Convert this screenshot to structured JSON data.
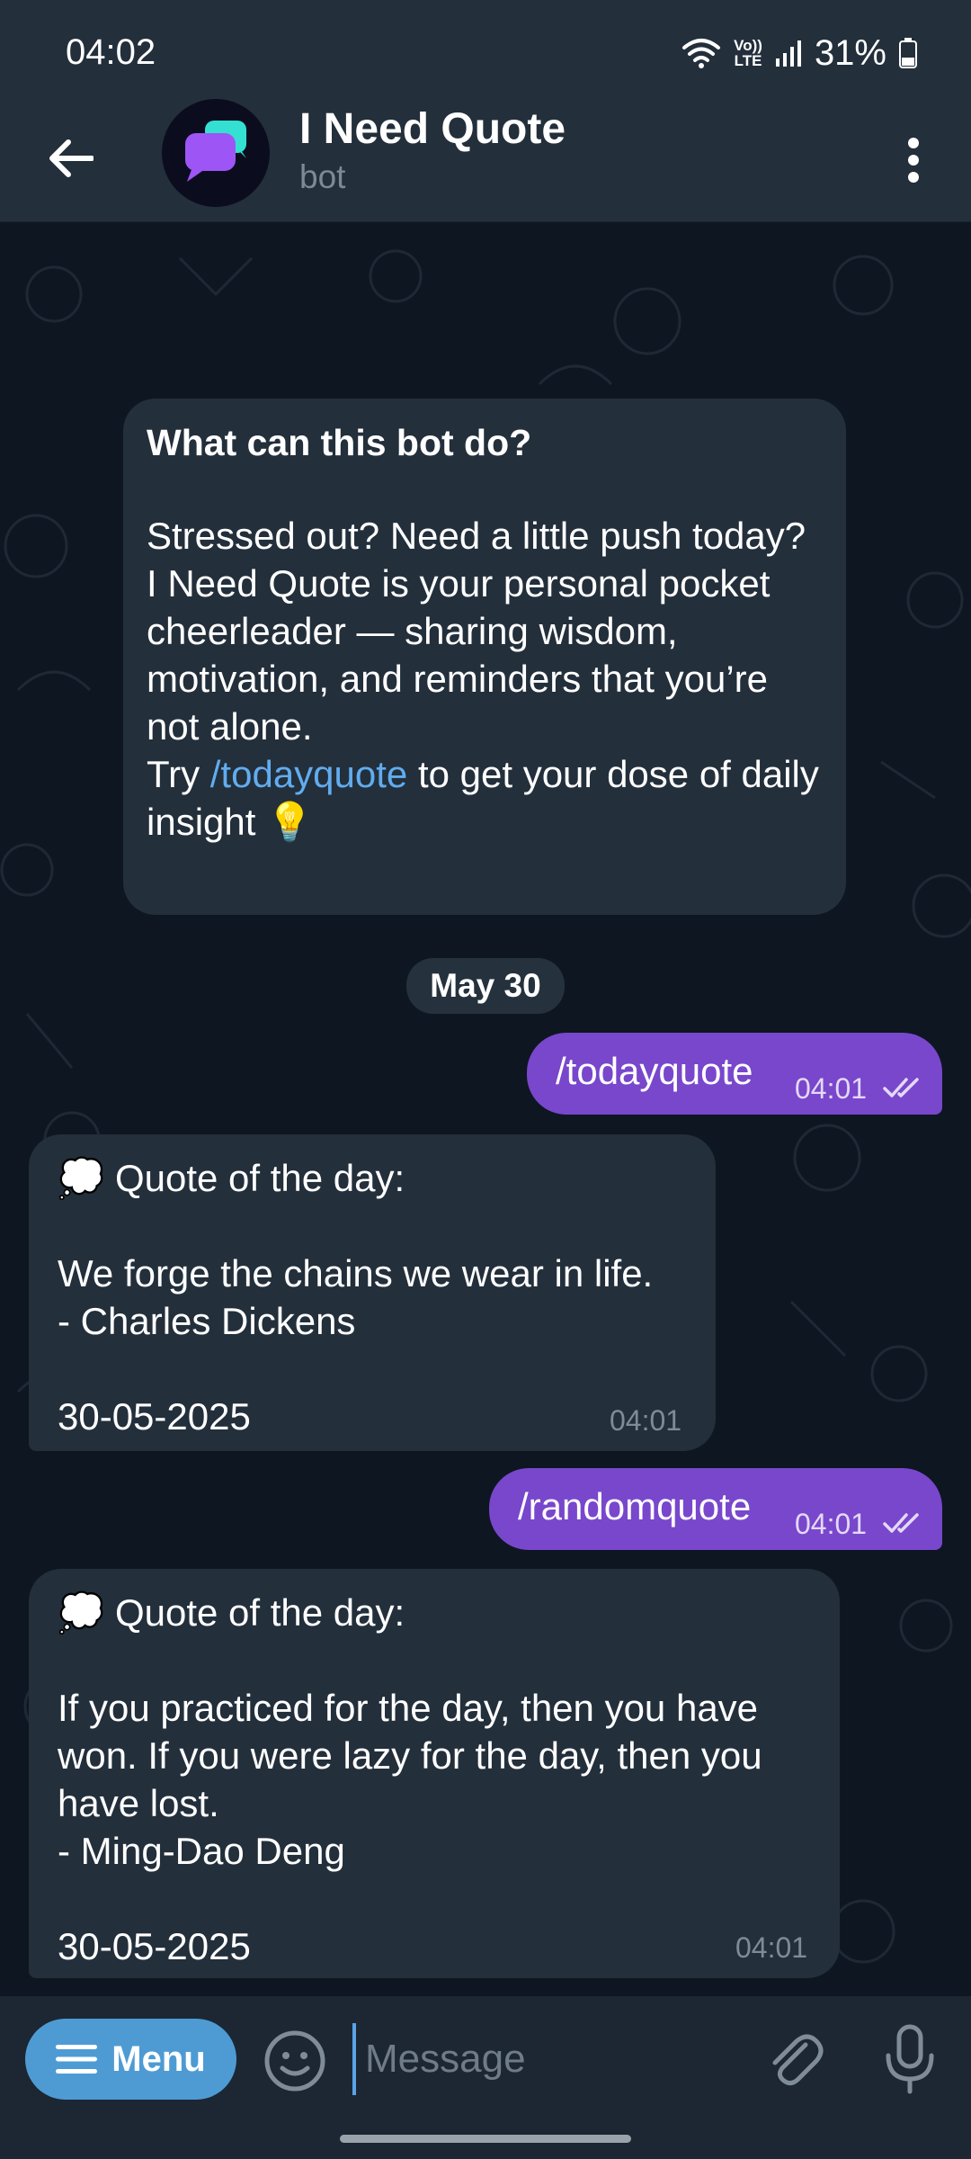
{
  "status_bar": {
    "time": "04:02",
    "battery": "31%",
    "network_label_top": "Vo))",
    "network_label_bottom": "LTE"
  },
  "header": {
    "title": "I Need Quote",
    "subtitle": "bot"
  },
  "intro": {
    "title": "What can this bot do?",
    "body_before_link": "Stressed out? Need a little push today?\nI Need Quote is your personal pocket cheerleader — sharing wisdom, motivation, and reminders that you’re not alone.\nTry ",
    "link": "/todayquote",
    "body_after_link": " to get your dose of daily insight 💡"
  },
  "date_separator": "May 30",
  "messages": [
    {
      "direction": "out",
      "text": "/todayquote",
      "time": "04:01"
    },
    {
      "direction": "in",
      "text": "💭 Quote of the day:\n\nWe forge the chains we wear in life.\n- Charles Dickens\n\n30-05-2025",
      "time": "04:01"
    },
    {
      "direction": "out",
      "text": "/randomquote",
      "time": "04:01"
    },
    {
      "direction": "in",
      "text": "💭 Quote of the day:\n\nIf you practiced for the day, then you have won. If you were lazy for the day, then you have lost.\n- Ming-Dao Deng\n\n30-05-2025",
      "time": "04:01"
    }
  ],
  "input_bar": {
    "menu_label": "Menu",
    "placeholder": "Message"
  },
  "colors": {
    "outgoing_bubble": "#7847cc",
    "incoming_bubble": "#232f3b",
    "link": "#61acef",
    "menu_button": "#4e9bd4"
  },
  "icons": [
    "back-arrow-icon",
    "more-vert-icon",
    "emoji-icon",
    "attach-icon",
    "mic-icon",
    "menu-lines-icon",
    "double-check-icon",
    "wifi-icon",
    "signal-icon",
    "battery-icon"
  ]
}
